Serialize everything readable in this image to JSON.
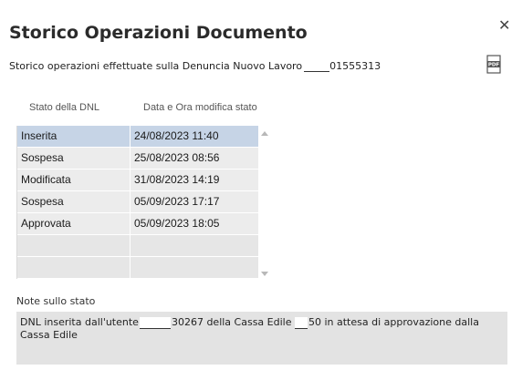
{
  "dialog": {
    "title": "Storico Operazioni Documento",
    "subtitle_prefix": "Storico operazioni effettuate sulla Denuncia Nuovo Lavoro",
    "subtitle_suffix": "01555313",
    "close_icon": "close-icon",
    "pdf_icon": "pdf-export-icon"
  },
  "grid": {
    "columns": [
      "Stato della DNL",
      "Data e Ora modifica stato"
    ],
    "rows": [
      {
        "stato": "Inserita",
        "data": "24/08/2023 11:40"
      },
      {
        "stato": "Sospesa",
        "data": "25/08/2023 08:56"
      },
      {
        "stato": "Modificata",
        "data": "31/08/2023 14:19"
      },
      {
        "stato": "Sospesa",
        "data": "05/09/2023 17:17"
      },
      {
        "stato": "Approvata",
        "data": "05/09/2023 18:05"
      },
      {
        "stato": "",
        "data": ""
      },
      {
        "stato": "",
        "data": ""
      }
    ]
  },
  "notes": {
    "label": "Note sullo stato",
    "text_part1": "DNL inserita dall'utente",
    "text_part2": "30267 della Cassa Edile",
    "text_part3": "50 in attesa di approvazione dalla Cassa Edile"
  },
  "colors": {
    "selected_row": "#c6d4e6",
    "cell_bg": "#ececec",
    "note_bg": "#e3e3e3"
  }
}
